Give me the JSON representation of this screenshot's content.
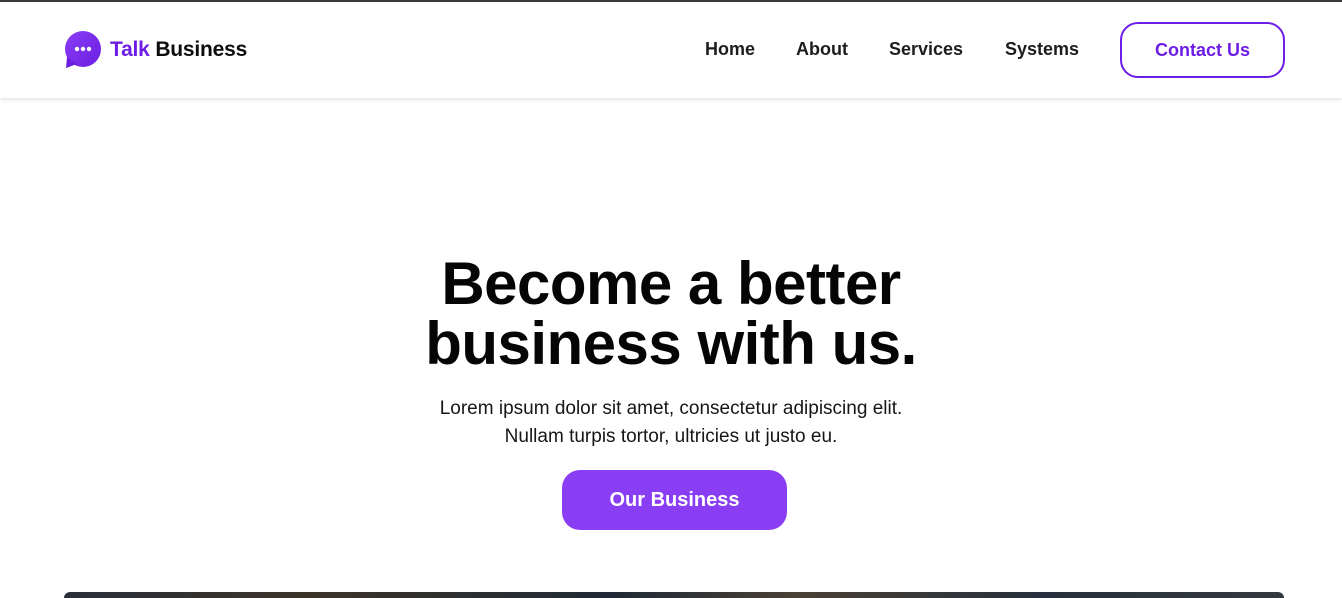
{
  "brand": {
    "name_accent": "Talk",
    "name_rest": "Business",
    "logo_icon": "chat-bubble-ellipsis-icon",
    "accent_color": "#6e1de6"
  },
  "nav": {
    "items": [
      {
        "label": "Home"
      },
      {
        "label": "About"
      },
      {
        "label": "Services"
      },
      {
        "label": "Systems"
      }
    ],
    "contact_label": "Contact Us"
  },
  "hero": {
    "title_line1": "Become a better",
    "title_line2": "business with us.",
    "subtitle_line1": "Lorem ipsum dolor sit amet, consectetur adipiscing elit.",
    "subtitle_line2": "Nullam turpis tortor, ultricies ut justo eu.",
    "cta_label": "Our Business",
    "cta_color": "#8a3ef3"
  }
}
